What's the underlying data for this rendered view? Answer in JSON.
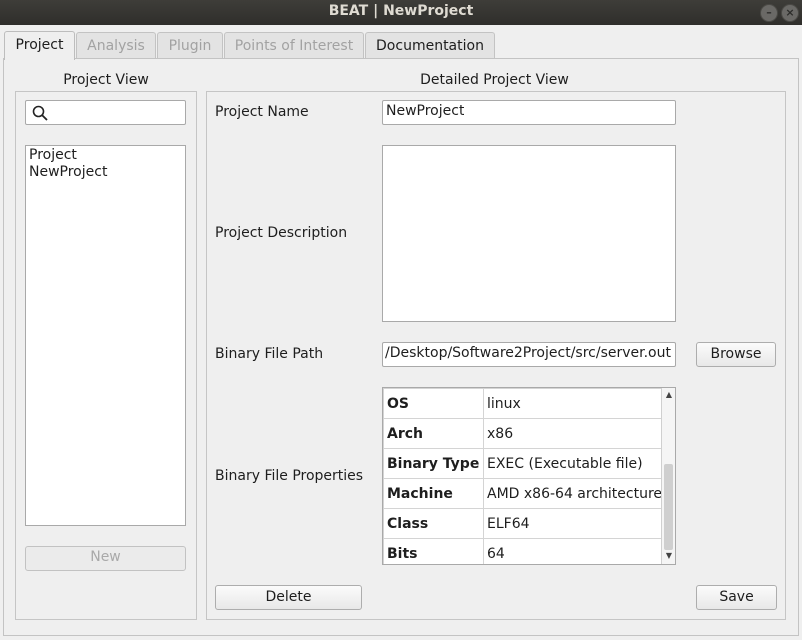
{
  "window": {
    "title": "BEAT | NewProject",
    "minimize_glyph": "–",
    "close_glyph": "×"
  },
  "tabs": [
    {
      "label": "Project",
      "state": "active"
    },
    {
      "label": "Analysis",
      "state": "disabled"
    },
    {
      "label": "Plugin",
      "state": "disabled"
    },
    {
      "label": "Points of Interest",
      "state": "disabled"
    },
    {
      "label": "Documentation",
      "state": "enabled"
    }
  ],
  "project_view": {
    "heading": "Project View",
    "search": {
      "value": "",
      "placeholder": "",
      "icon": "search-icon"
    },
    "tree_items": [
      "Project",
      "NewProject"
    ],
    "new_button": "New"
  },
  "detail": {
    "heading": "Detailed Project View",
    "name_label": "Project Name",
    "name_value": "NewProject",
    "description_label": "Project Description",
    "description_value": "",
    "binary_path_label": "Binary File Path",
    "binary_path_value": "/Desktop/Software2Project/src/server.out",
    "browse_button": "Browse",
    "properties_label": "Binary File Properties",
    "properties": [
      {
        "key": "OS",
        "value": "linux"
      },
      {
        "key": "Arch",
        "value": "x86"
      },
      {
        "key": "Binary Type",
        "value": "EXEC (Executable file)"
      },
      {
        "key": "Machine",
        "value": "AMD x86-64 architecture"
      },
      {
        "key": "Class",
        "value": "ELF64"
      },
      {
        "key": "Bits",
        "value": "64"
      }
    ],
    "delete_button": "Delete",
    "save_button": "Save"
  },
  "colors": {
    "titlebar": "#3e3d39",
    "window_bg": "#efefef",
    "disabled_text": "#a2a2a2"
  }
}
